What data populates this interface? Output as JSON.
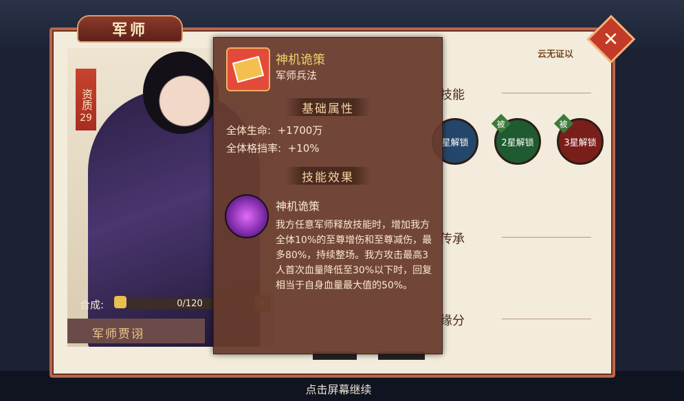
{
  "window": {
    "title": "军师",
    "close_label": "✕"
  },
  "hero": {
    "aptitude_label": "资质",
    "aptitude_value": "29",
    "synthesis_label": "合成:",
    "synthesis_progress": "0/120",
    "synthesis_add": "+",
    "name": "军师贾诩"
  },
  "right_panel": {
    "star_label": "云无证以",
    "sections": {
      "skill": "技能",
      "inherit": "传承",
      "fate": "缘分"
    },
    "skills": [
      {
        "tag": "",
        "label": "星解锁",
        "color": "#25466b"
      },
      {
        "tag": "被",
        "label": "2星解锁",
        "color": "#1f5a30"
      },
      {
        "tag": "被",
        "label": "3星解锁",
        "color": "#7a1e1a"
      }
    ]
  },
  "tooltip": {
    "icon": "strategy-book-icon",
    "name": "神机诡策",
    "type": "军师兵法",
    "base_title": "基础属性",
    "stats": [
      {
        "label": "全体生命:",
        "value": "+1700万"
      },
      {
        "label": "全体格挡率:",
        "value": "+10%"
      }
    ],
    "effect_title": "技能效果",
    "effect_icon": "purple-orb-icon",
    "effect_name": "神机诡策",
    "effect_desc": "我方任意军师释放技能时，增加我方全体10%的至尊增伤和至尊减伤，最多80%，持续整场。我方攻击最高3人首次血量降低至30%以下时，回复相当于自身血量最大值的50%。"
  },
  "footer": {
    "continue": "点击屏幕继续"
  },
  "colors": {
    "accent": "#c33a28",
    "panel": "#f3ebdb",
    "tooltip": "#683c2e",
    "gold": "#f5cf67"
  }
}
